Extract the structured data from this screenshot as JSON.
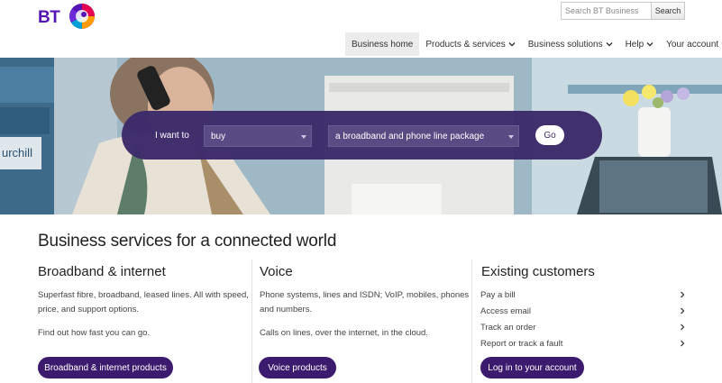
{
  "header": {
    "logo_text": "BT",
    "search_placeholder": "Search BT Business",
    "search_button": "Search",
    "nav": [
      {
        "label": "Business home",
        "dropdown": false,
        "active": true
      },
      {
        "label": "Products & services",
        "dropdown": true,
        "active": false
      },
      {
        "label": "Business solutions",
        "dropdown": true,
        "active": false
      },
      {
        "label": "Help",
        "dropdown": true,
        "active": false
      },
      {
        "label": "Your account",
        "dropdown": true,
        "active": false
      }
    ]
  },
  "hero": {
    "i_want_to": "I want to",
    "select_action": "buy",
    "select_product": "a broadband and phone line package",
    "go_button": "Go",
    "background_sign": "urchill"
  },
  "main": {
    "title": "Business services for a connected world",
    "columns": [
      {
        "title": "Broadband & internet",
        "text": "Superfast fibre, broadband, leased lines. All with speed, price, and support options.",
        "text2": "Find out how fast you can go.",
        "button": "Broadband & internet products"
      },
      {
        "title": "Voice",
        "text": "Phone systems, lines and ISDN; VoIP, mobiles, phones and numbers.",
        "text2": "Calls on lines, over the internet, in the cloud.",
        "button": "Voice products"
      },
      {
        "title": "Existing customers",
        "links": [
          "Pay a bill",
          "Access email",
          "Track an order",
          "Report or track a fault"
        ],
        "button": "Log in to your account"
      }
    ]
  },
  "colors": {
    "brand_purple": "#5514b4",
    "ribbon": "#3c2a6a",
    "button": "#3c1a6e"
  }
}
